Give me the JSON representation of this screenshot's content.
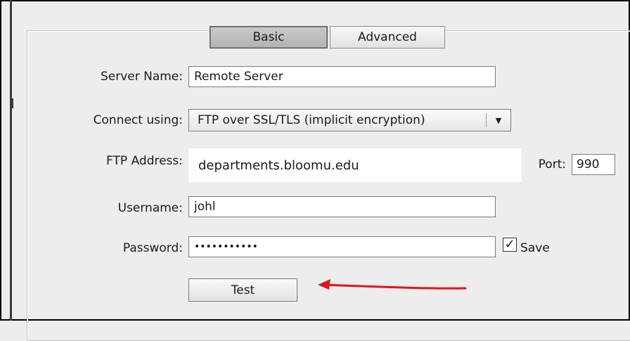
{
  "tabs": {
    "basic": "Basic",
    "advanced": "Advanced"
  },
  "form": {
    "server_name": {
      "label": "Server Name:",
      "value": "Remote Server"
    },
    "connect_using": {
      "label": "Connect using:",
      "value": "FTP over SSL/TLS (implicit encryption)"
    },
    "ftp_address": {
      "label": "FTP Address:",
      "value": "departments.bloomu.edu"
    },
    "port": {
      "label": "Port:",
      "value": "990"
    },
    "username": {
      "label": "Username:",
      "value": "johl"
    },
    "password": {
      "label": "Password:",
      "value": "•••••••••••"
    },
    "save": {
      "label": "Save",
      "checked": true,
      "check_glyph": "✓"
    }
  },
  "buttons": {
    "test": "Test"
  },
  "annotation": {
    "arrow_color": "#e0161b",
    "arrow_icon": "red-arrow-icon"
  },
  "icons": {
    "dropdown": "▼"
  }
}
